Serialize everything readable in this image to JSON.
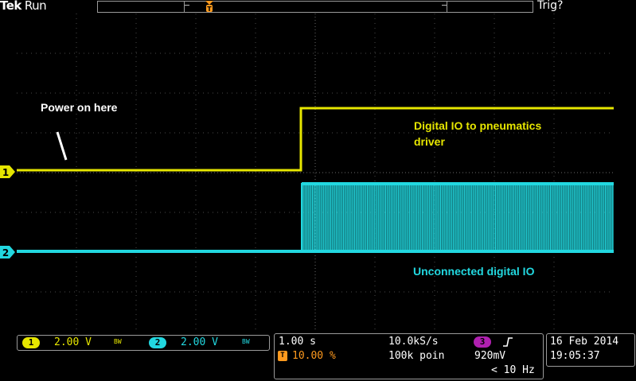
{
  "header": {
    "brand": "Tek",
    "run_status": "Run",
    "trigger_status": "Trig?"
  },
  "colors": {
    "ch1": "#e6e600",
    "ch2": "#22d8e0",
    "ch3": "#b020b0",
    "trigger": "#ff9a1e",
    "grid": "#5a5a5a"
  },
  "markers": {
    "trigger_marker": "T",
    "ch1_marker": "1",
    "ch2_marker": "2"
  },
  "annotations": {
    "power_on": "Power on here",
    "ch1_label_line1": "Digital IO to pneumatics",
    "ch1_label_line2": "driver",
    "ch2_label": "Unconnected digital IO"
  },
  "channels": [
    {
      "number": "1",
      "scale": "2.00 V",
      "bw": "BW"
    },
    {
      "number": "2",
      "scale": "2.00 V",
      "bw": "BW"
    }
  ],
  "timebase": {
    "time_per_div": "1.00 s",
    "sample_rate": "10.0kS/s",
    "trigger_position": "10.00 %",
    "record_length": "100k poin",
    "trigger_source": "3",
    "trigger_slope": "rising-edge-icon",
    "trigger_level": "920mV",
    "trigger_freq": "< 10 Hz"
  },
  "datetime": {
    "date": "16 Feb 2014",
    "time": "19:05:37"
  }
}
